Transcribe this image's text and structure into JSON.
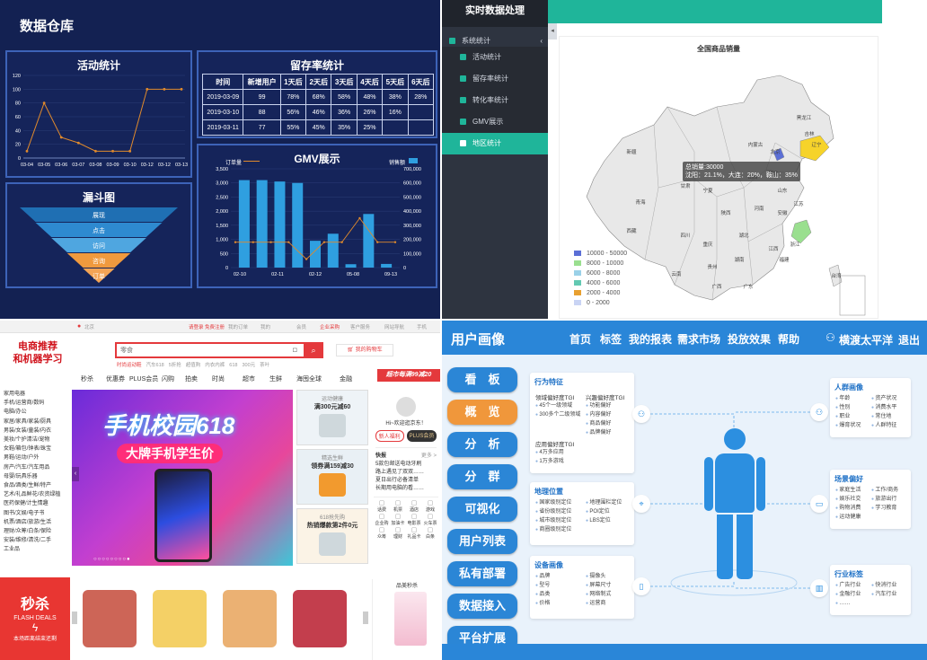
{
  "q1": {
    "title": "数据仓库",
    "activity": {
      "title": "活动统计",
      "ylabels": [
        "0",
        "20",
        "40",
        "60",
        "80",
        "100",
        "120"
      ],
      "xlabels": [
        "03-04",
        "03-05",
        "03-06",
        "03-07",
        "03-08",
        "03-09",
        "03-10",
        "03-12",
        "03-12",
        "03-13"
      ],
      "values": [
        10,
        80,
        30,
        22,
        10,
        10,
        10,
        100,
        100,
        100
      ]
    },
    "retention": {
      "title": "留存率统计",
      "headers": [
        "时间",
        "新增用户",
        "1天后",
        "2天后",
        "3天后",
        "4天后",
        "5天后",
        "6天后"
      ],
      "rows": [
        [
          "2019-03-09",
          "99",
          "78%",
          "68%",
          "58%",
          "48%",
          "38%",
          "28%"
        ],
        [
          "2019-03-10",
          "88",
          "56%",
          "46%",
          "36%",
          "26%",
          "16%",
          ""
        ],
        [
          "2019-03-11",
          "77",
          "55%",
          "45%",
          "35%",
          "25%",
          "",
          ""
        ]
      ]
    },
    "funnel": {
      "title": "漏斗图",
      "stages": [
        "展现",
        "点击",
        "访问",
        "咨询",
        "订单"
      ]
    },
    "gmv": {
      "title": "GMV展示",
      "legend_left": "订单量",
      "legend_right": "销售额",
      "yleft": [
        "0",
        "500",
        "1,000",
        "1,500",
        "2,000",
        "2,500",
        "3,000",
        "3,500"
      ],
      "yright": [
        "0",
        "100,000",
        "200,000",
        "300,000",
        "400,000",
        "500,000",
        "600,000",
        "700,000"
      ],
      "xlabels": [
        "02-10",
        "02-11",
        "02-12",
        "05-08",
        "09-13"
      ]
    }
  },
  "q2": {
    "sidebar_title": "实时数据处理",
    "menu": [
      {
        "label": "系统统计",
        "kind": "top"
      },
      {
        "label": "活动统计",
        "kind": "sub"
      },
      {
        "label": "留存率统计",
        "kind": "sub"
      },
      {
        "label": "转化率统计",
        "kind": "sub"
      },
      {
        "label": "GMV展示",
        "kind": "sub"
      },
      {
        "label": "地区统计",
        "kind": "active"
      }
    ],
    "chart_title": "全国商品销量",
    "tooltip_line1": "总销量:30000",
    "tooltip_line2": "沈阳：21.1%，大连：20%，鞍山：35%",
    "legend": [
      "10000 - 50000",
      "8000 - 10000",
      "6000 - 8000",
      "4000 - 6000",
      "2000 - 4000",
      "0 - 2000"
    ],
    "legend_colors": [
      "#5b6fd6",
      "#9adf8f",
      "#9ad1e8",
      "#63c9b2",
      "#e8a030",
      "#c9d4f4"
    ],
    "map_labels": [
      "新疆",
      "西藏",
      "青海",
      "甘肃",
      "内蒙古",
      "黑龙江",
      "吉林",
      "辽宁",
      "北京",
      "山西",
      "河北",
      "山东",
      "江苏",
      "安徽",
      "四川",
      "重庆",
      "湖北",
      "湖南",
      "贵州",
      "云南",
      "广西",
      "广东",
      "福建",
      "台湾",
      "浙江",
      "江西",
      "陕西",
      "河南",
      "宁夏"
    ]
  },
  "q3": {
    "brand_line1": "电商推荐",
    "brand_line2": "和机器学习",
    "topbar_items": [
      "北京",
      "请登录 免费注册",
      "我的订单",
      "我的",
      "会员",
      "企业采购",
      "客户服务",
      "网站导航",
      "手机"
    ],
    "search_placeholder": "零食",
    "cart_label": "我的购物车",
    "hot_words": [
      "时尚运动鞋",
      "汽车618",
      "5折抢",
      "超值购",
      "内衣内裤",
      "618",
      "300元",
      "茶叶"
    ],
    "nav": [
      "秒杀",
      "优惠券",
      "PLUS会员",
      "闪购",
      "拍卖",
      "时尚",
      "超市",
      "生鲜",
      "海囤全球",
      "金融"
    ],
    "categories": [
      "家用电器",
      "手机/运营商/数码",
      "电脑/办公",
      "家居/家具/家装/厨具",
      "男装/女装/童装/内衣",
      "美妆/个护清洁/宠物",
      "女鞋/箱包/钟表/珠宝",
      "男鞋/运动/户外",
      "房产/汽车/汽车用品",
      "母婴/玩具乐器",
      "食品/酒类/生鲜/特产",
      "艺术/礼品鲜花/农资绿植",
      "医药保健/计生情趣",
      "图书/文娱/电子书",
      "机票/酒店/旅游/生活",
      "理财/众筹/白条/保险",
      "安装/维修/清洗/二手",
      "工业品"
    ],
    "banner_title": "手机校园618",
    "banner_sub": "大牌手机学生价",
    "promo_tag": "超市每满99减20",
    "side_ads": [
      {
        "title": "运动健康",
        "text": "满300元减60"
      },
      {
        "title": "精选生鲜",
        "text": "领券满159减30"
      },
      {
        "title": "618抢先购",
        "text": "热销爆款第2件0元"
      }
    ],
    "user_greeting": "Hi~欢迎逛京东！",
    "user_buttons": [
      "登录",
      "注册",
      "新人福利",
      "PLUS会员"
    ],
    "news_title": "快报",
    "news_more": "更多 >",
    "news": [
      "5款包邮送电动牙刷",
      "路上遇见了双双……",
      "夏日出行必备清单",
      "长期用电脑的看……"
    ],
    "services": [
      "话费",
      "机票",
      "酒店",
      "游戏",
      "企业购",
      "加油卡",
      "电影票",
      "火车票",
      "众筹",
      "理财",
      "礼品卡",
      "白条"
    ],
    "flash_title": "秒杀",
    "flash_en": "FLASH DEALS",
    "flash_sub": "本场距离结束还剩",
    "brand_promo": "品美秒杀"
  },
  "q4": {
    "logo": "用户画像",
    "nav": [
      "首页",
      "标签",
      "我的报表",
      "需求市场",
      "投放效果",
      "帮助"
    ],
    "username": "横渡太平洋",
    "logout": "退出",
    "menu": [
      "看　板",
      "概　览",
      "分　析",
      "分　群",
      "可视化",
      "用户列表",
      "私有部署",
      "数据接入",
      "平台扩展"
    ],
    "selected_menu": 1,
    "behavior": {
      "title": "行为特征",
      "col1_title": "领域偏好度TGI",
      "col1": [
        "45个一级领域",
        "300多个二级领域"
      ],
      "col2_title": "兴趣偏好度TGI",
      "col2": [
        "功能偏好",
        "内容偏好",
        "商品偏好",
        "品牌偏好"
      ],
      "col3_title": "应用偏好度TGI",
      "col3": [
        "4万多应用",
        "1万多游戏"
      ]
    },
    "geo": {
      "title": "地理位置",
      "col1": [
        "国家级别定位",
        "省份级别定位",
        "城市级别定位",
        "商圈级别定位"
      ],
      "col2": [
        "地理围栏定位",
        "POI定位",
        "LBS定位"
      ]
    },
    "device": {
      "title": "设备画像",
      "col1": [
        "品牌",
        "型号",
        "品类",
        "价格"
      ],
      "col2": [
        "摄像头",
        "屏幕尺寸",
        "网络制式",
        "运营商"
      ]
    },
    "crowd": {
      "title": "人群画像",
      "col1": [
        "年龄",
        "性别",
        "职业",
        "爆育状况"
      ],
      "col2": [
        "资产状况",
        "消费水平",
        "常住地",
        "人群特征"
      ]
    },
    "scene": {
      "title": "场景偏好",
      "col1": [
        "家庭生活",
        "娱乐社交",
        "购物消费",
        "运动健康"
      ],
      "col2": [
        "工作/商务",
        "旅游出行",
        "学习教育"
      ]
    },
    "industry": {
      "title": "行业标签",
      "col1": [
        "广告行业",
        "金融行业",
        "……"
      ],
      "col2": [
        "快消行业",
        "汽车行业"
      ]
    }
  }
}
